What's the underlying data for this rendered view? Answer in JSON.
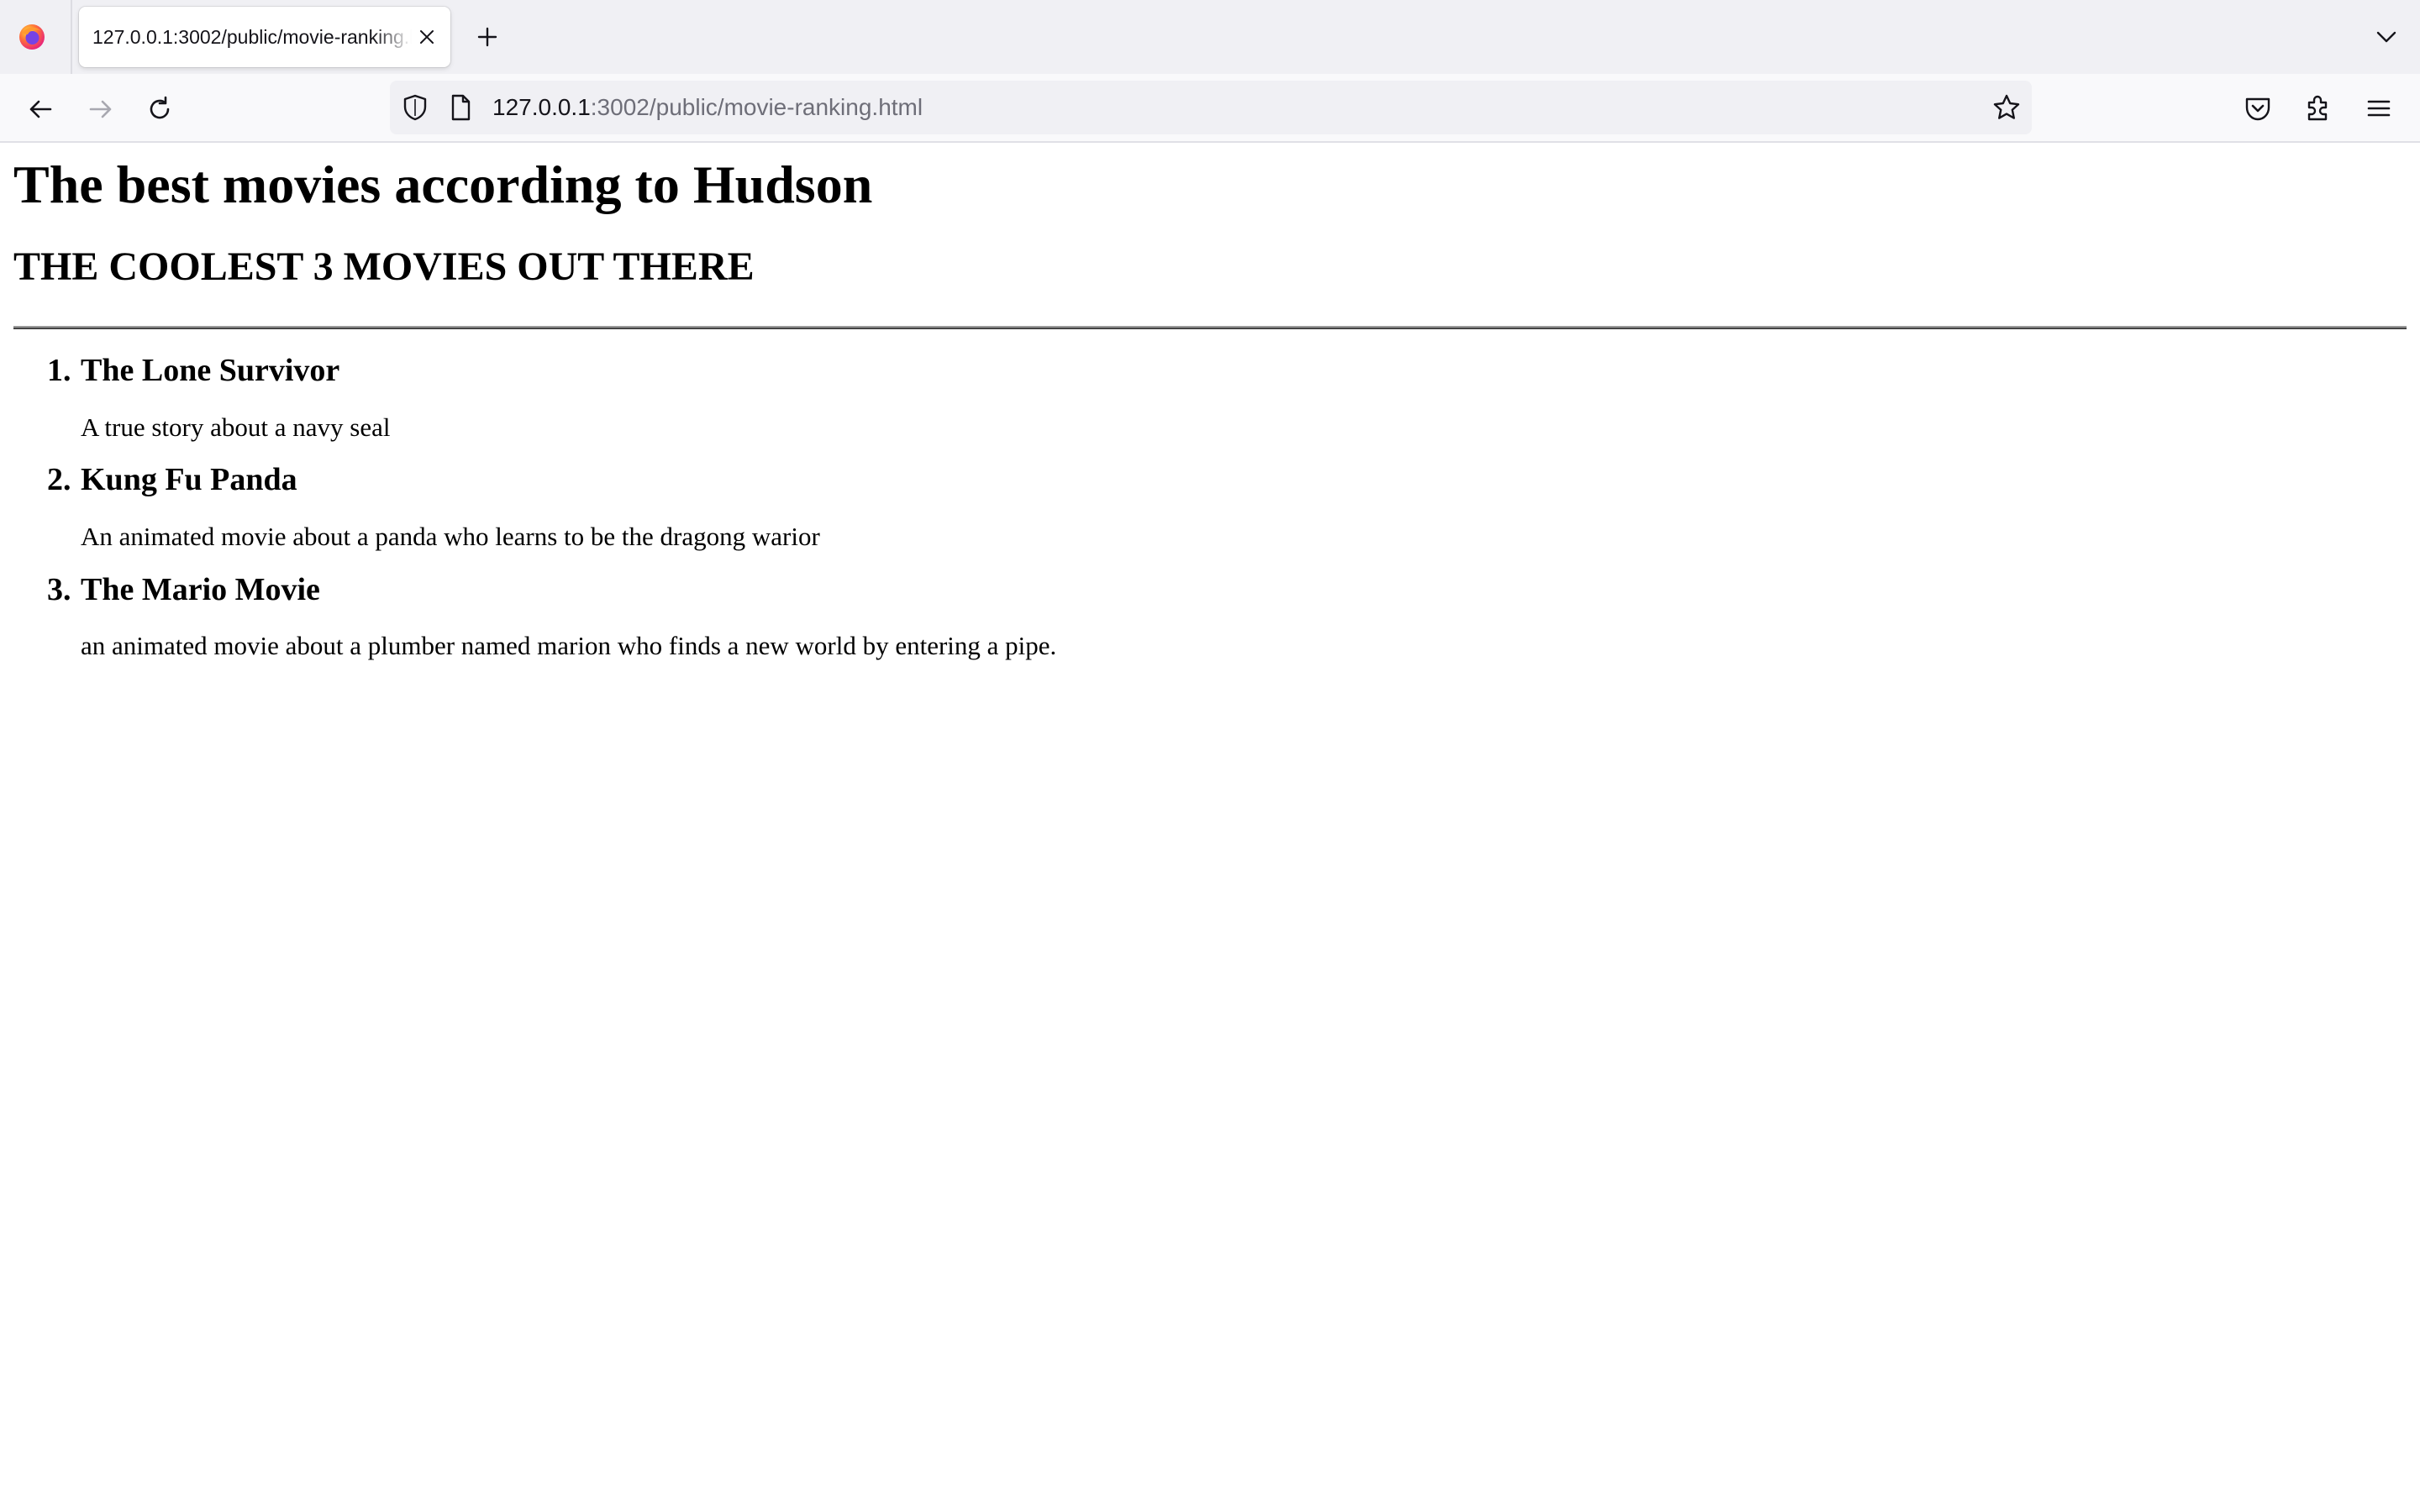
{
  "browser": {
    "tab": {
      "title": "127.0.0.1:3002/public/movie-ranking.html"
    },
    "url": {
      "host": "127.0.0.1",
      "path": ":3002/public/movie-ranking.html"
    },
    "icons": {
      "logo": "firefox-logo",
      "tab_close": "close-icon",
      "new_tab": "plus-icon",
      "tab_list": "chevron-down-icon",
      "back": "back-arrow-icon",
      "forward": "forward-arrow-icon",
      "reload": "reload-icon",
      "shield": "shield-icon",
      "page": "page-icon",
      "bookmark": "star-icon",
      "pocket": "pocket-icon",
      "extensions": "puzzle-icon",
      "menu": "hamburger-menu-icon"
    }
  },
  "page": {
    "title": "The best movies according to Hudson",
    "subtitle": "THE COOLEST 3 MOVIES OUT THERE",
    "movies": [
      {
        "rank": "1.",
        "title": "The Lone Survivor",
        "description": "A true story about a navy seal"
      },
      {
        "rank": "2.",
        "title": "Kung Fu Panda",
        "description": "An animated movie about a panda who learns to be the dragong warior"
      },
      {
        "rank": "3.",
        "title": "The Mario Movie",
        "description": "an animated movie about a plumber named marion who finds a new world by entering a pipe."
      }
    ]
  }
}
